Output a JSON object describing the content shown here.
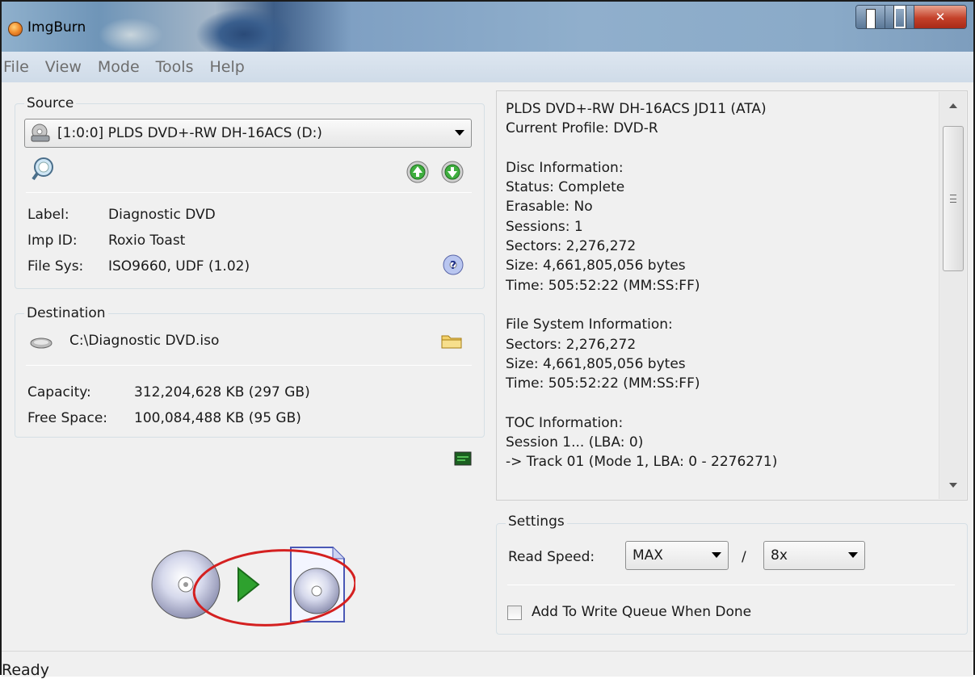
{
  "window": {
    "title": "ImgBurn"
  },
  "menu": [
    "File",
    "View",
    "Mode",
    "Tools",
    "Help"
  ],
  "source": {
    "title": "Source",
    "drive": "[1:0:0] PLDS DVD+-RW DH-16ACS (D:)",
    "rows": [
      {
        "label": "Label:",
        "value": "Diagnostic DVD"
      },
      {
        "label": "Imp ID:",
        "value": "Roxio Toast"
      },
      {
        "label": "File Sys:",
        "value": "ISO9660, UDF (1.02)"
      }
    ]
  },
  "destination": {
    "title": "Destination",
    "path": "C:\\Diagnostic DVD.iso",
    "rows": [
      {
        "label": "Capacity:",
        "value": "312,204,628 KB  (297 GB)"
      },
      {
        "label": "Free Space:",
        "value": "100,084,488 KB  (95 GB)"
      }
    ]
  },
  "info_lines": [
    "PLDS DVD+-RW DH-16ACS JD11 (ATA)",
    "Current Profile: DVD-R",
    "",
    "Disc Information:",
    "Status: Complete",
    "Erasable: No",
    "Sessions: 1",
    "Sectors: 2,276,272",
    "Size: 4,661,805,056 bytes",
    "Time: 505:52:22 (MM:SS:FF)",
    "",
    "File System Information:",
    "Sectors: 2,276,272",
    "Size: 4,661,805,056 bytes",
    "Time: 505:52:22 (MM:SS:FF)",
    "",
    "TOC Information:",
    "Session 1... (LBA: 0)",
    "-> Track 01  (Mode 1, LBA: 0 - 2276271)"
  ],
  "settings": {
    "title": "Settings",
    "read_speed_label": "Read Speed:",
    "read_speed_value": "MAX",
    "slash": "/",
    "second_value": "8x",
    "queue_label": "Add To Write Queue When Done"
  },
  "status": "Ready",
  "colors": {
    "annotation": "#d42020",
    "play": "#2ea12e"
  }
}
